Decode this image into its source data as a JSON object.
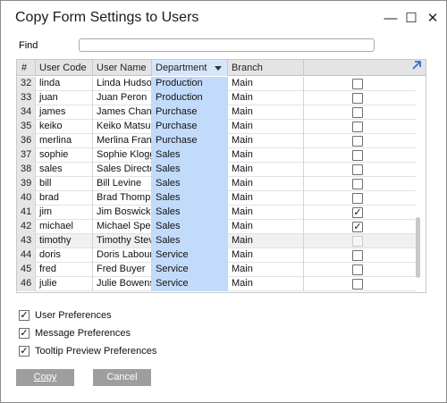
{
  "window": {
    "title": "Copy Form Settings to Users",
    "minimize_glyph": "—",
    "maximize_glyph": "☐",
    "close_glyph": "✕"
  },
  "find": {
    "label": "Find",
    "value": "",
    "placeholder": ""
  },
  "grid": {
    "columns": [
      "#",
      "User Code",
      "User Name",
      "Department",
      "Branch",
      ""
    ],
    "sorted_column": "Department",
    "rows": [
      {
        "num": "32",
        "code": "linda",
        "name": "Linda Hudson",
        "dept": "Production",
        "branch": "Main",
        "checked": false
      },
      {
        "num": "33",
        "code": "juan",
        "name": "Juan Peron",
        "dept": "Production",
        "branch": "Main",
        "checked": false
      },
      {
        "num": "34",
        "code": "james",
        "name": "James Chan",
        "dept": "Purchase",
        "branch": "Main",
        "checked": false
      },
      {
        "num": "35",
        "code": "keiko",
        "name": "Keiko Matsui",
        "dept": "Purchase",
        "branch": "Main",
        "checked": false
      },
      {
        "num": "36",
        "code": "merlina",
        "name": "Merlina Franc",
        "dept": "Purchase",
        "branch": "Main",
        "checked": false
      },
      {
        "num": "37",
        "code": "sophie",
        "name": "Sophie Klogg",
        "dept": "Sales",
        "branch": "Main",
        "checked": false
      },
      {
        "num": "38",
        "code": "sales",
        "name": "Sales Director",
        "dept": "Sales",
        "branch": "Main",
        "checked": false
      },
      {
        "num": "39",
        "code": "bill",
        "name": "Bill Levine",
        "dept": "Sales",
        "branch": "Main",
        "checked": false
      },
      {
        "num": "40",
        "code": "brad",
        "name": "Brad Thompso",
        "dept": "Sales",
        "branch": "Main",
        "checked": false
      },
      {
        "num": "41",
        "code": "jim",
        "name": "Jim Boswick",
        "dept": "Sales",
        "branch": "Main",
        "checked": true
      },
      {
        "num": "42",
        "code": "michael",
        "name": "Michael Spear",
        "dept": "Sales",
        "branch": "Main",
        "checked": true
      },
      {
        "num": "43",
        "code": "timothy",
        "name": "Timothy Steve",
        "dept": "Sales",
        "branch": "Main",
        "checked": false,
        "disabled": true
      },
      {
        "num": "44",
        "code": "doris",
        "name": "Doris Labour",
        "dept": "Service",
        "branch": "Main",
        "checked": false
      },
      {
        "num": "45",
        "code": "fred",
        "name": "Fred Buyer",
        "dept": "Service",
        "branch": "Main",
        "checked": false
      },
      {
        "num": "46",
        "code": "julie",
        "name": "Julie Bowens",
        "dept": "Service",
        "branch": "Main",
        "checked": false
      }
    ]
  },
  "options": [
    {
      "label": "User Preferences",
      "checked": true
    },
    {
      "label": "Message Preferences",
      "checked": true
    },
    {
      "label": "Tooltip Preview Preferences",
      "checked": true
    }
  ],
  "buttons": {
    "copy": "Copy",
    "cancel": "Cancel"
  },
  "icons": {
    "expand": "expand-arrow-icon",
    "check": "✓"
  },
  "colors": {
    "selected_column": "#c3dbfb",
    "header_bg": "#e4e4e4",
    "button_bg": "#9e9e9e",
    "expand_icon": "#2f6fd0"
  }
}
